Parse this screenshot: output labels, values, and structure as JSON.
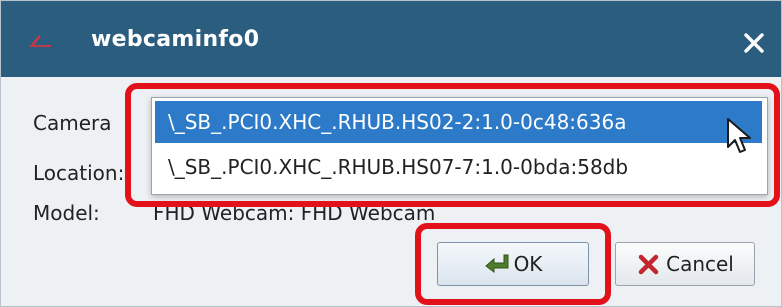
{
  "window": {
    "title": "webcaminfo0",
    "close_glyph": "✕"
  },
  "form": {
    "camera_label": "Camera",
    "location_label": "Location:",
    "model_label": "Model:",
    "model_value": "FHD Webcam: FHD Webcam"
  },
  "camera_dropdown": {
    "options": [
      "\\_SB_.PCI0.XHC_.RHUB.HS02-2:1.0-0c48:636a",
      "\\_SB_.PCI0.XHC_.RHUB.HS07-7:1.0-0bda:58db"
    ],
    "selected_index": 0
  },
  "buttons": {
    "ok_label": "OK",
    "cancel_label": "Cancel"
  },
  "colors": {
    "titlebar": "#2b5d7f",
    "selection": "#2d7bc8",
    "highlight_annotation": "#e3121a"
  },
  "icons": {
    "app": "app-logo-icon",
    "close": "close-icon",
    "ok": "check-arrow-icon",
    "cancel": "red-x-icon",
    "cursor": "mouse-pointer-icon"
  }
}
